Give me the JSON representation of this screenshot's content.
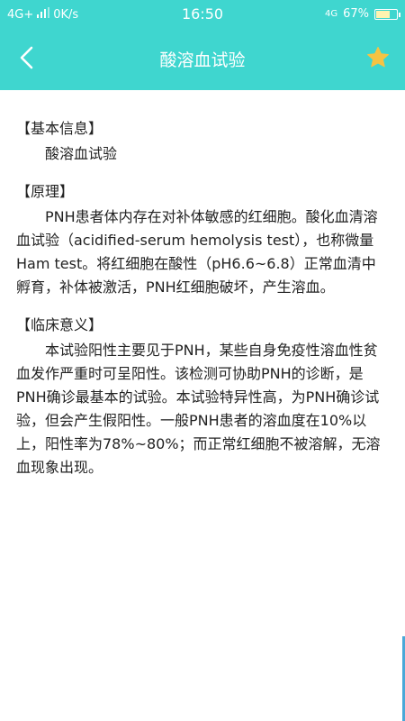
{
  "status_bar": {
    "network": "4G+",
    "speed": "0K/s",
    "time": "16:50",
    "signal_right": "4G",
    "battery": "67%",
    "battery_level": 0.67
  },
  "navbar": {
    "title": "酸溶血试验",
    "back_icon": "chevron-left-icon",
    "favorite_icon": "star-icon",
    "accent_color": "#3fd6cf",
    "star_color": "#f6c343"
  },
  "sections": [
    {
      "heading": "【基本信息】",
      "text": "酸溶血试验"
    },
    {
      "heading": "【原理】",
      "text": "PNH患者体内存在对补体敏感的红细胞。酸化血清溶血试验（acidified-serum hemolysis test），也称微量Ham test。将红细胞在酸性（pH6.6~6.8）正常血清中孵育，补体被激活，PNH红细胞破坏，产生溶血。"
    },
    {
      "heading": "【临床意义】",
      "text": "本试验阳性主要见于PNH，某些自身免疫性溶血性贫血发作严重时可呈阳性。该检测可协助PNH的诊断，是PNH确诊最基本的试验。本试验特异性高，为PNH确诊试验，但会产生假阳性。一般PNH患者的溶血度在10%以上，阳性率为78%~80%；而正常红细胞不被溶解，无溶血现象出现。"
    }
  ]
}
